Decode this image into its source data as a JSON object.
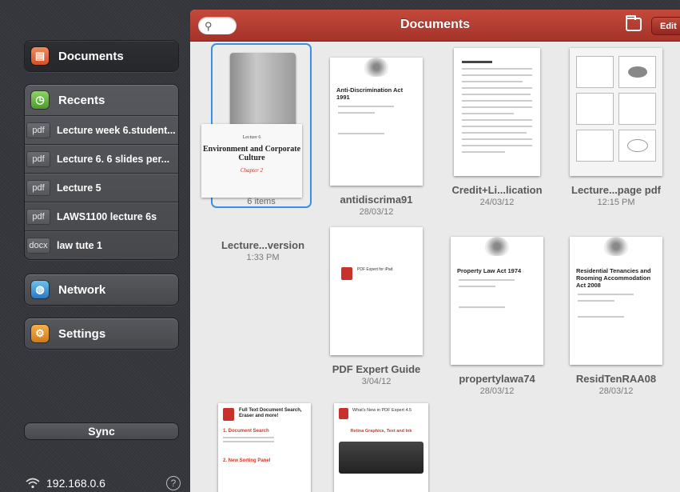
{
  "sidebar": {
    "documents": "Documents",
    "recents": "Recents",
    "recent_files": [
      {
        "type": "pdf",
        "name": "Lecture week 6.student..."
      },
      {
        "type": "pdf",
        "name": "Lecture 6. 6 slides per..."
      },
      {
        "type": "pdf",
        "name": "Lecture 5"
      },
      {
        "type": "pdf",
        "name": "LAWS1100 lecture 6s"
      },
      {
        "type": "docx",
        "name": "law tute 1"
      }
    ],
    "network": "Network",
    "settings": "Settings",
    "sync": "Sync",
    "ip": "192.168.0.6",
    "help": "?"
  },
  "topbar": {
    "title": "Documents",
    "edit": "Edit"
  },
  "folder": {
    "cover_top": "Lecture 6",
    "cover_title": "Environment and Corporate Culture",
    "cover_sub": "Chapter 2",
    "count": "6 items",
    "name": "Lecture...version",
    "date": "1:33 PM"
  },
  "files": [
    {
      "name": "antidiscrima91",
      "date": "28/03/12",
      "doc_title": "Anti-Discrimination Act 1991"
    },
    {
      "name": "Credit+Li...lication",
      "date": "24/03/12"
    },
    {
      "name": "Lecture...page pdf",
      "date": "12:15 PM"
    },
    {
      "name": "PDF Expert Guide",
      "date": "3/04/12",
      "doc_title": "PDF Expert for iPad"
    },
    {
      "name": "propertylawa74",
      "date": "28/03/12",
      "doc_title": "Property Law Act 1974"
    },
    {
      "name": "ResidTenRAA08",
      "date": "28/03/12",
      "doc_title": "Residential Tenancies and Rooming Accommodation Act 2008"
    }
  ],
  "promo1": {
    "title": "Full Text Document Search, Eraser and more!",
    "s1": "1. Document Search",
    "s2": "2. New Sorting Panel"
  },
  "promo2": {
    "title": "What's New in PDF Expert 4.5",
    "s1": "Retina Graphics, Text and Ink"
  }
}
